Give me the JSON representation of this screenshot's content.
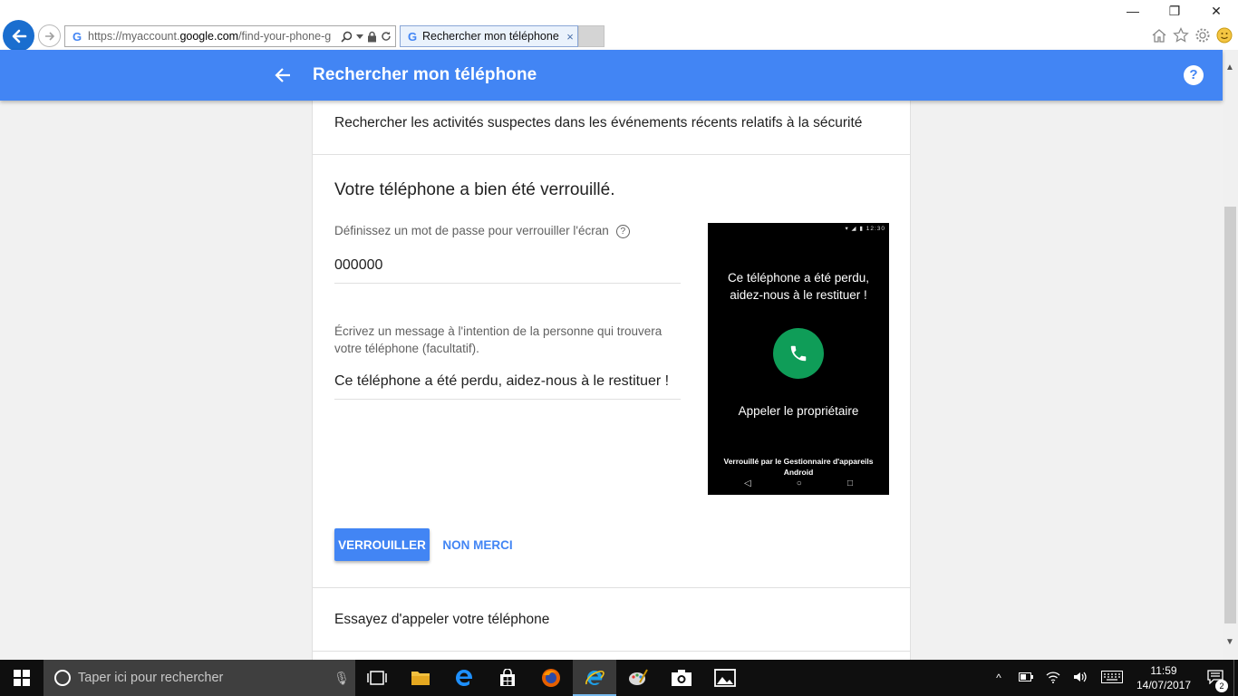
{
  "browser": {
    "url_prefix": "https://myaccount.",
    "url_domain": "google.com",
    "url_path": "/find-your-phone-g",
    "tab_title": "Rechercher mon téléphone",
    "tab_close": "×",
    "window_minimize": "—",
    "window_restore": "❐",
    "window_close": "✕"
  },
  "appbar": {
    "title": "Rechercher mon téléphone",
    "help": "?"
  },
  "page": {
    "suspicious_activity": "Rechercher les activités suspectes dans les événements récents relatifs à la sécurité",
    "lock_heading": "Votre téléphone a bien été verrouillé.",
    "password_label": "Définissez un mot de passe pour verrouiller l'écran",
    "password_help": "?",
    "password_value": "000000",
    "message_label": "Écrivez un message à l'intention de la personne qui trouvera votre téléphone (facultatif).",
    "message_value": "Ce téléphone a été perdu, aidez-nous à le restituer !",
    "lock_button": "VERROUILLER",
    "decline_button": "NON MERCI",
    "call_phone": "Essayez d'appeler votre téléphone"
  },
  "phone_preview": {
    "status_time": "12:30",
    "message": "Ce téléphone a été perdu, aidez-nous à le restituer !",
    "call_owner": "Appeler le propriétaire",
    "locked_by": "Verrouillé par le Gestionnaire d'appareils Android",
    "nav_back": "◁",
    "nav_home": "○",
    "nav_recents": "□"
  },
  "taskbar": {
    "search_placeholder": "Taper ici pour rechercher",
    "clock_time": "11:59",
    "clock_date": "14/07/2017",
    "notification_count": "2"
  },
  "colors": {
    "accent": "#4285f4",
    "call_green": "#0f9d58",
    "taskbar": "#0f0f0f",
    "ie_blue": "#1a6ecf"
  }
}
